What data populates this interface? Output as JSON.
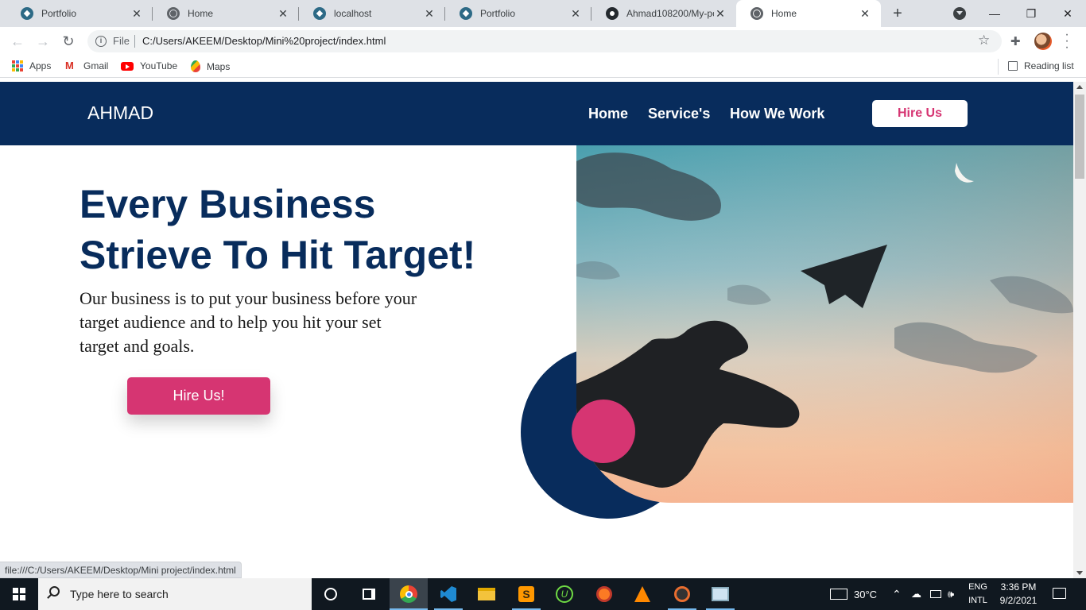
{
  "browser": {
    "tabs": [
      {
        "title": "Portfolio",
        "icon": "portfolio-favicon"
      },
      {
        "title": "Home",
        "icon": "globe-icon"
      },
      {
        "title": "localhost",
        "icon": "portfolio-favicon"
      },
      {
        "title": "Portfolio",
        "icon": "portfolio-favicon"
      },
      {
        "title": "Ahmad108200/My-po",
        "icon": "github-icon"
      },
      {
        "title": "Home",
        "icon": "globe-icon",
        "active": true
      }
    ],
    "new_tab": "+",
    "window_controls": {
      "minimize": "—",
      "restore": "❐",
      "close": "✕"
    },
    "address": {
      "scheme_label": "File",
      "url": "C:/Users/AKEEM/Desktop/Mini%20project/index.html"
    },
    "bookmarks": [
      {
        "label": "Apps",
        "icon": "apps-grid-icon"
      },
      {
        "label": "Gmail",
        "icon": "gmail-icon"
      },
      {
        "label": "YouTube",
        "icon": "youtube-icon"
      },
      {
        "label": "Maps",
        "icon": "maps-icon"
      }
    ],
    "reading_list": "Reading list",
    "status_url": "file:///C:/Users/AKEEM/Desktop/Mini project/index.html"
  },
  "site": {
    "logo": "AHMAD",
    "nav": [
      {
        "label": "Home"
      },
      {
        "label": "Service's"
      },
      {
        "label": "How We Work"
      }
    ],
    "nav_button": "Hire Us",
    "hero": {
      "title_line1": "Every Business",
      "title_line2": "Strieve To Hit Target!",
      "text": "Our business is to put your business before your target audience and to help you hit your set target and goals.",
      "button": "Hire Us!"
    },
    "colors": {
      "navy": "#082c5c",
      "pink": "#d63572",
      "white": "#ffffff"
    }
  },
  "taskbar": {
    "search_placeholder": "Type here to search",
    "apps": [
      "cortana-icon",
      "task-view-icon",
      "chrome-icon",
      "vscode-icon",
      "file-explorer-icon",
      "sublime-icon",
      "upwork-icon",
      "xampp-icon",
      "vlc-icon",
      "media-player-icon",
      "photos-icon"
    ],
    "weather": "30°C",
    "language_line1": "ENG",
    "language_line2": "INTL",
    "time": "3:36 PM",
    "date": "9/2/2021"
  }
}
